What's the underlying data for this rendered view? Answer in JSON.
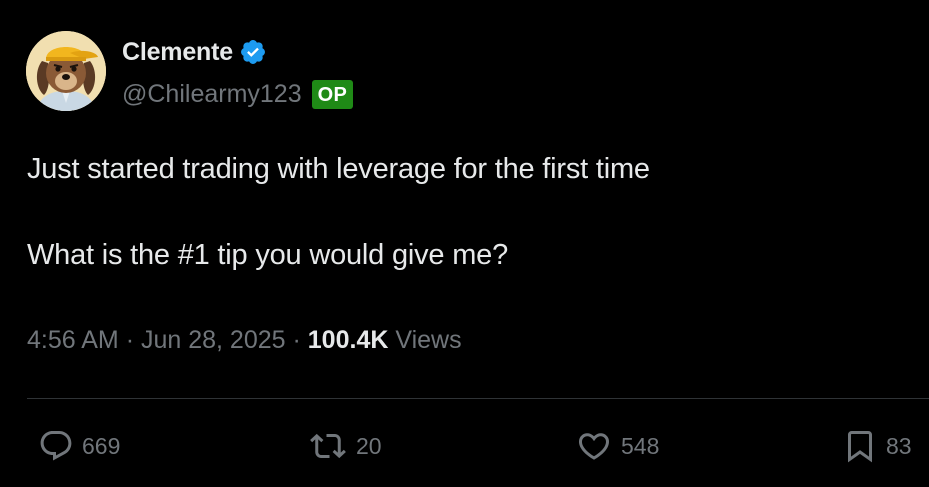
{
  "user": {
    "display_name": "Clemente",
    "handle": "@Chilearmy123",
    "op_badge": "OP",
    "verified": true
  },
  "tweet": {
    "text": "Just started trading with leverage for the first time\n\nWhat is the #1 tip you would give me?",
    "time": "4:56 AM",
    "separator": "·",
    "date": "Jun 28, 2025",
    "views_count": "100.4K",
    "views_label": "Views"
  },
  "actions": {
    "replies": "669",
    "reposts": "20",
    "likes": "548",
    "bookmarks": "83"
  },
  "colors": {
    "background": "#000000",
    "text_primary": "#e7e9ea",
    "text_secondary": "#71767b",
    "verified_blue": "#1d9bf0",
    "op_badge_green": "#1f8a16",
    "divider": "#2f3336"
  },
  "icons": {
    "avatar": "avatar-dog-with-yellow-cap",
    "verified": "verified-badge-icon",
    "reply": "reply-icon",
    "repost": "repost-icon",
    "like": "heart-icon",
    "bookmark": "bookmark-icon"
  }
}
